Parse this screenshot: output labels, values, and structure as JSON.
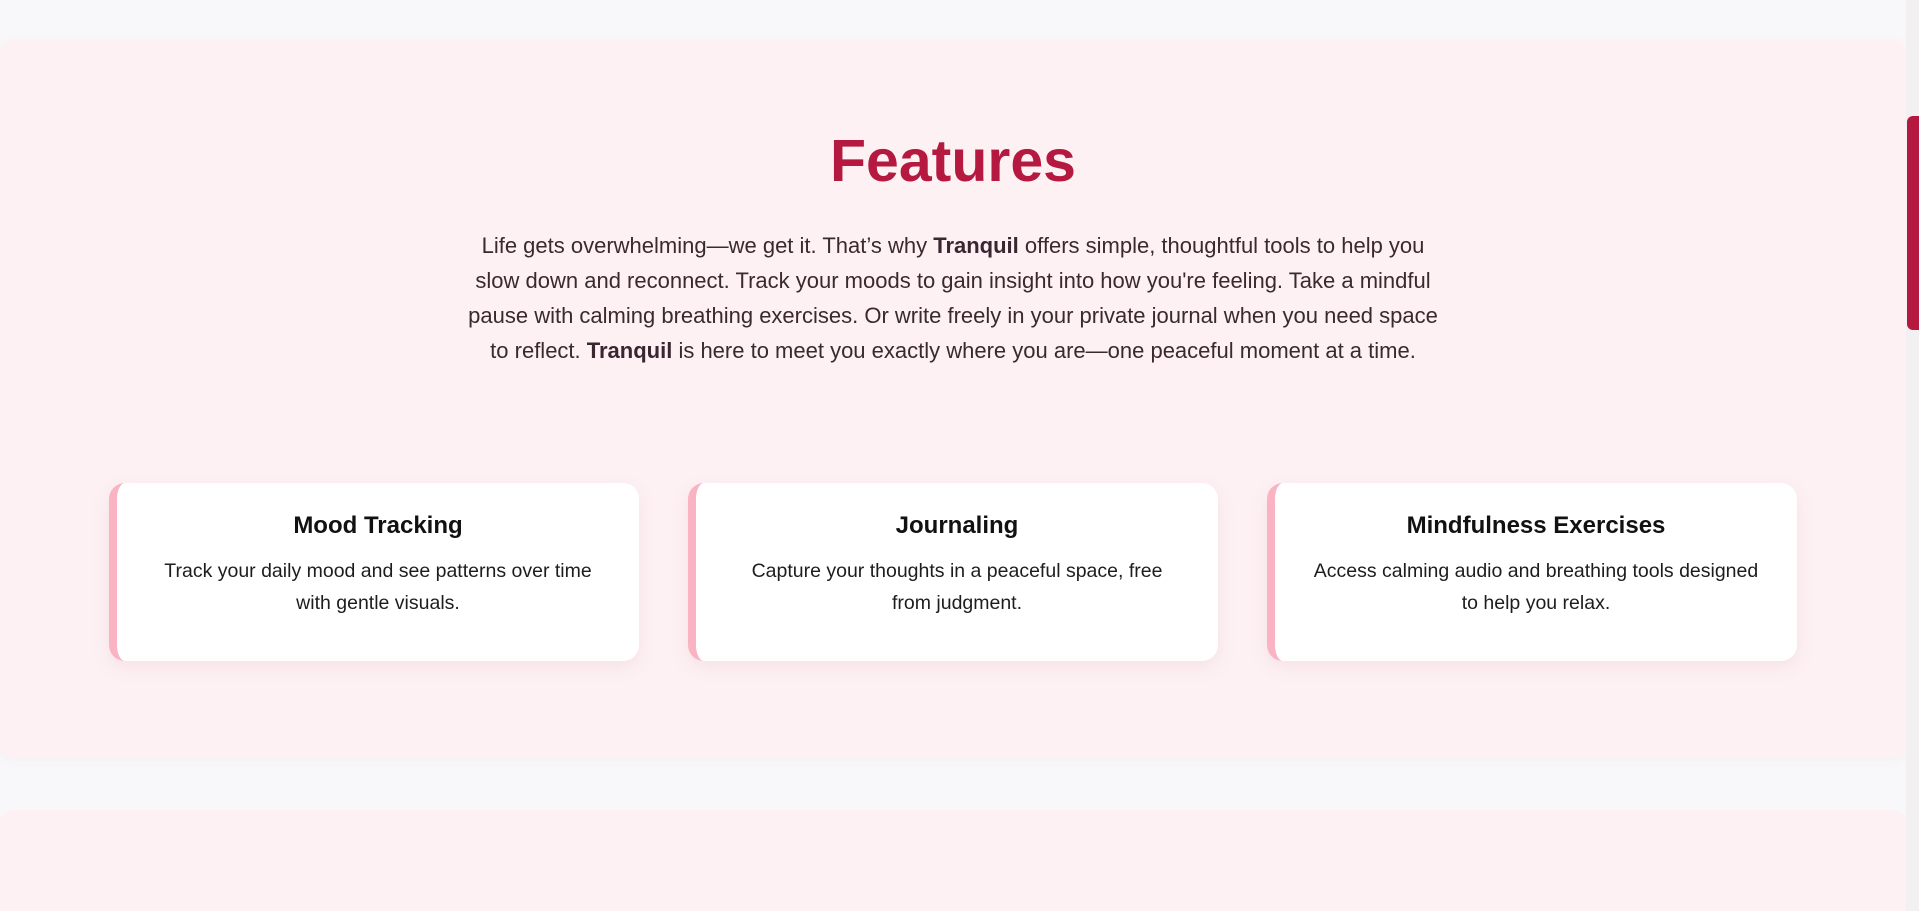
{
  "features": {
    "title": "Features",
    "intro": {
      "part1": "Life gets overwhelming—we get it. That’s why ",
      "brand1": "Tranquil",
      "part2": " offers simple, thoughtful tools to help you slow down and reconnect. Track your moods to gain insight into how you're feeling. Take a mindful pause with calming breathing exercises. Or write freely in your private journal when you need space to reflect. ",
      "brand2": "Tranquil",
      "part3": " is here to meet you exactly where you are—one peaceful moment at a time."
    },
    "cards": [
      {
        "title": "Mood Tracking",
        "description": "Track your daily mood and see patterns over time with gentle visuals."
      },
      {
        "title": "Journaling",
        "description": "Capture your thoughts in a peaceful space, free from judgment."
      },
      {
        "title": "Mindfulness Exercises",
        "description": "Access calming audio and breathing tools designed to help you relax."
      }
    ]
  },
  "colors": {
    "accent": "#b5193f",
    "section_background": "#fdf1f4",
    "card_border": "#f9b3c3",
    "page_background": "#f8f7f9"
  }
}
